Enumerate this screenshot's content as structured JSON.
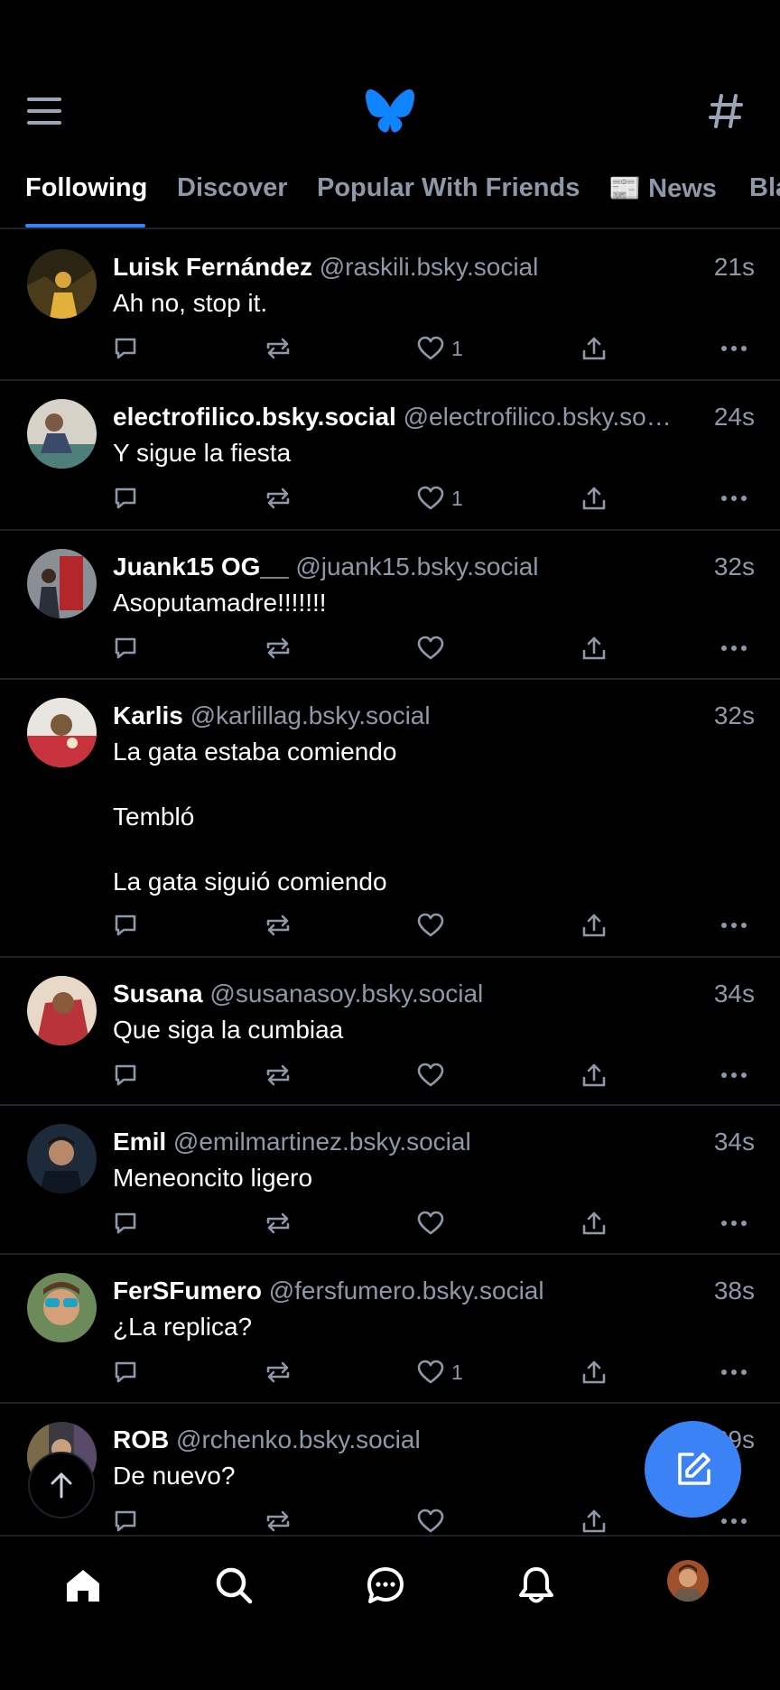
{
  "header": {
    "tabs": [
      {
        "label": "Following",
        "active": true
      },
      {
        "label": "Discover",
        "active": false
      },
      {
        "label": "Popular With Friends",
        "active": false
      },
      {
        "label": "📰 News",
        "active": false
      },
      {
        "label": "Bla",
        "active": false
      }
    ],
    "accent_color": "#3b82f6"
  },
  "posts": [
    {
      "name": "Luisk Fernández",
      "handle": "@raskili.bsky.social",
      "time": "21s",
      "text": "Ah no, stop it.",
      "likes": "1"
    },
    {
      "name": "electrofilico.bsky.social",
      "handle": "@electrofilico.bsky.so…",
      "time": "24s",
      "text": "Y sigue la fiesta",
      "likes": "1"
    },
    {
      "name": "Juank15 OG__",
      "handle": "@juank15.bsky.social",
      "time": "32s",
      "text": "Asoputamadre!!!!!!!",
      "likes": ""
    },
    {
      "name": "Karlis",
      "handle": "@karlillag.bsky.social",
      "time": "32s",
      "text": "La gata estaba comiendo\n\nTembló\n\nLa gata siguió comiendo",
      "likes": ""
    },
    {
      "name": "Susana",
      "handle": "@susanasoy.bsky.social",
      "time": "34s",
      "text": "Que siga la cumbiaa",
      "likes": ""
    },
    {
      "name": "Emil",
      "handle": "@emilmartinez.bsky.social",
      "time": "34s",
      "text": "Meneoncito ligero",
      "likes": ""
    },
    {
      "name": "FerSFumero",
      "handle": "@fersfumero.bsky.social",
      "time": "38s",
      "text": "¿La replica?",
      "likes": "1"
    },
    {
      "name": "ROB",
      "handle": "@rchenko.bsky.social",
      "time": "39s",
      "text": "De nuevo?",
      "likes": ""
    }
  ],
  "icons": {
    "menu": "hamburger-menu-icon",
    "logo": "butterfly-logo-icon",
    "feeds": "hashtag-icon",
    "reply": "speech-bubble-icon",
    "repost": "repost-icon",
    "like": "heart-icon",
    "share": "share-icon",
    "more": "more-dots-icon",
    "compose": "compose-icon",
    "scroll_top": "arrow-up-icon",
    "nav": [
      "home-icon",
      "search-icon",
      "chat-icon",
      "bell-icon",
      "profile-avatar"
    ]
  }
}
